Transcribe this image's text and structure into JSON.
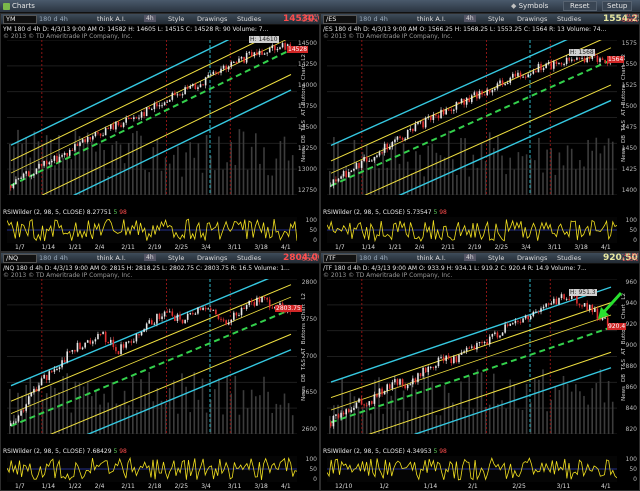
{
  "window": {
    "title": "Charts",
    "symbols_label": "Symbols",
    "reset_label": "Reset",
    "setup_label": "Setup"
  },
  "side_tabs": [
    "L2",
    "Chart",
    "Buttons",
    "AT",
    "T&S",
    "DB",
    "News"
  ],
  "panels": [
    {
      "symbol": "YM",
      "aggregation": "180 d 4h",
      "toolbar": {
        "think": "think A.I.",
        "agg": "4h",
        "style": "Style",
        "drawings": "Drawings",
        "studies": "Studies"
      },
      "price": "14530.00",
      "change": "-54.00\n-0.35%",
      "info": "YM 180 d 4h   D: 4/3/13 9:00 AM   O: 14582  H: 14605  L: 14515  C: 14528  R: 90  Volume: 7...",
      "copyright": "© 2013 © TD Ameritrade IP Company, Inc.",
      "price_label": "14528",
      "high_label": "H: 14610",
      "y_ticks": [
        "14500",
        "14250",
        "14000",
        "13750",
        "13500",
        "13250",
        "13000",
        "12750"
      ],
      "x_ticks": [
        "1/7",
        "1/14",
        "1/21",
        "2/4",
        "2/11",
        "2/19",
        "2/25",
        "3/4",
        "3/11",
        "3/18",
        "4/1"
      ],
      "rsi": {
        "name": "RSIWilder (2, 98, 5, CLOSE)",
        "value": "8.27751",
        "mid": "5",
        "upper": "98"
      },
      "rsi_ticks": [
        "100",
        "50",
        "0"
      ],
      "chart_data": {
        "type": "line",
        "series": [
          {
            "values": [
              12820,
              12900,
              12980,
              13050,
              13120,
              13180,
              13230,
              13310,
              13390,
              13460,
              13520,
              13590,
              13640,
              13700,
              13760,
              13830,
              13880,
              13950,
              14010,
              14080,
              14140,
              14210,
              14280,
              14340,
              14400,
              14460,
              14510,
              14560,
              14600,
              14528
            ]
          }
        ],
        "ylim": [
          12700,
          14650
        ]
      }
    },
    {
      "symbol": "/ES",
      "aggregation": "180 d 4h",
      "toolbar": {
        "think": "think A.I.",
        "agg": "4h",
        "style": "Style",
        "drawings": "Drawings",
        "studies": "Studies"
      },
      "price": "1554.25",
      "change": "-0.25\n-0.66%",
      "info": "/ES 180 d 4h   D: 4/3/13 9:00 AM   O: 1566.25  H: 1568.25  L: 1553.25  C: 1564  R: 13  Volume: 74...",
      "copyright": "© 2013 © TD Ameritrade IP Company, Inc.",
      "price_label": "1564",
      "high_label": "H: 1568",
      "y_ticks": [
        "1575",
        "1550",
        "1525",
        "1500",
        "1475",
        "1450",
        "1425",
        "1400"
      ],
      "x_ticks": [
        "1/7",
        "1/14",
        "1/21",
        "2/4",
        "2/11",
        "2/19",
        "2/25",
        "3/4",
        "3/11",
        "3/18",
        "4/1"
      ],
      "rsi": {
        "name": "RSIWilder (2, 98, 5, CLOSE)",
        "value": "5.73547",
        "mid": "5",
        "upper": "98"
      },
      "rsi_ticks": [
        "100",
        "50",
        "0"
      ],
      "chart_data": {
        "type": "line",
        "series": [
          {
            "values": [
              1402,
              1412,
              1421,
              1430,
              1438,
              1447,
              1455,
              1463,
              1470,
              1478,
              1486,
              1492,
              1498,
              1505,
              1511,
              1518,
              1524,
              1530,
              1536,
              1541,
              1547,
              1551,
              1555,
              1559,
              1562,
              1565,
              1567,
              1568,
              1566,
              1564
            ]
          }
        ],
        "ylim": [
          1390,
          1590
        ]
      }
    },
    {
      "symbol": "/NQ",
      "aggregation": "180 d 4h",
      "toolbar": {
        "think": "think A.I.",
        "agg": "4h",
        "style": "Style",
        "drawings": "Drawings",
        "studies": "Studies"
      },
      "price": "2804.00",
      "change": "-11.75\n-0.31%",
      "info": "/NQ 180 d 4h   D: 4/3/13 9:00 AM   O: 2815  H: 2818.25  L: 2802.75  C: 2803.75  R: 16.5  Volume: 1...",
      "copyright": "© 2013 © TD Ameritrade IP Company, Inc.",
      "price_label": "2803.75",
      "high_label": "",
      "y_ticks": [
        "2800",
        "2750",
        "2700",
        "2650",
        "2600"
      ],
      "x_ticks": [
        "1/7",
        "1/14",
        "1/22",
        "2/4",
        "2/11",
        "2/18",
        "2/25",
        "3/4",
        "3/11",
        "3/18",
        "4/1"
      ],
      "rsi": {
        "name": "RSIWilder (2, 98, 5, CLOSE)",
        "value": "7.68429",
        "mid": "5",
        "upper": "98"
      },
      "rsi_ticks": [
        "100",
        "50",
        "0"
      ],
      "chart_data": {
        "type": "line",
        "series": [
          {
            "values": [
              2585,
              2610,
              2640,
              2665,
              2680,
              2700,
              2720,
              2735,
              2740,
              2760,
              2748,
              2725,
              2740,
              2755,
              2770,
              2785,
              2795,
              2790,
              2780,
              2800,
              2810,
              2795,
              2775,
              2790,
              2805,
              2815,
              2820,
              2812,
              2808,
              2803
            ]
          }
        ],
        "ylim": [
          2570,
          2860
        ]
      }
    },
    {
      "symbol": "/TF",
      "aggregation": "180 d 4h",
      "toolbar": {
        "think": "think A.I.",
        "agg": "4h",
        "style": "Style",
        "drawings": "Drawings",
        "studies": "Studies"
      },
      "price": "920.50",
      "change": "-11.80\n-1.25%",
      "info": "/TF 180 d 4h   D: 4/3/13 9:00 AM   O: 933.9  H: 934.1  L: 919.2  C: 920.4  R: 14.9  Volume: 7...",
      "copyright": "© 2013 © TD Ameritrade IP Company, Inc.",
      "price_label": "920.4",
      "high_label": "H: 951.3",
      "y_ticks": [
        "960",
        "940",
        "920",
        "900",
        "880",
        "860",
        "840",
        "820"
      ],
      "x_ticks": [
        "12/10",
        "1/2",
        "1/14",
        "2/1",
        "2/25",
        "3/11",
        "4/1"
      ],
      "rsi": {
        "name": "RSIWilder (2, 98, 5, CLOSE)",
        "value": "4.34953",
        "mid": "5",
        "upper": "98"
      },
      "rsi_ticks": [
        "100",
        "50",
        "0"
      ],
      "chart_data": {
        "type": "line",
        "series": [
          {
            "values": [
              822,
              830,
              838,
              846,
              842,
              852,
              860,
              866,
              858,
              870,
              878,
              884,
              890,
              886,
              896,
              900,
              906,
              912,
              918,
              924,
              930,
              936,
              942,
              946,
              950,
              951,
              944,
              938,
              930,
              920
            ]
          }
        ],
        "ylim": [
          810,
          970
        ]
      }
    }
  ]
}
